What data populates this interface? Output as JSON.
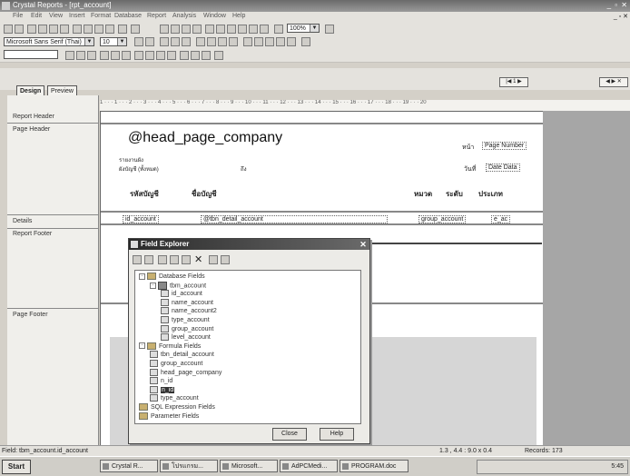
{
  "window": {
    "title": "Crystal Reports - [rpt_account]"
  },
  "menu": [
    "File",
    "Edit",
    "View",
    "Insert",
    "Format",
    "Database",
    "Report",
    "Analysis",
    "Window",
    "Help"
  ],
  "toolbar": {
    "zoom": "100%",
    "font_name": "Microsoft Sans Serif (Thai)",
    "font_size": "10"
  },
  "tabs": [
    {
      "label": "Design"
    },
    {
      "label": "Preview"
    }
  ],
  "nav": {
    "counter": "1"
  },
  "sections": {
    "report_header": "Report Header",
    "page_header": "Page Header",
    "details": "Details",
    "report_footer": "Report Footer",
    "page_footer": "Page Footer"
  },
  "ruler": "1 · · · 1 · · · 2 · · · 3 · · · 4 · · · 5 · · · 6 · · · 7 · · · 8 · · · 9 · · · 10 · · · 11 · · · 12 · · · 13 · · · 14 · · · 15 · · · 16 · · · 17 · · · 18 · · · 19 · · · 20",
  "report": {
    "company_field": "@head_page_company",
    "page_label": "หน้า",
    "page_number": "Page Number",
    "date_label": "วันที่",
    "date_field": "Date Data",
    "title_line1": "รายงานผัง",
    "title_line2": "ผังบัญชี (ทั้งหมด)",
    "small_label": "ถึง",
    "col_code": "รหัสบัญชี",
    "col_name": "ชื่อบัญชี",
    "col_group": "หมวด",
    "col_level": "ระดับ",
    "col_type": "ประเภท",
    "det_id": "id_account",
    "det_name": "@tbn_detail_account",
    "det_group": "group_account",
    "det_type": "e_ac"
  },
  "field_explorer": {
    "title": "Field Explorer",
    "close_label": "Close",
    "help_label": "Help",
    "tree": [
      {
        "label": "Database Fields",
        "indent": 0,
        "kind": "folder",
        "expanded": "-"
      },
      {
        "label": "tbm_account",
        "indent": 1,
        "kind": "table",
        "expanded": "-"
      },
      {
        "label": "id_account",
        "indent": 2,
        "kind": "field"
      },
      {
        "label": "name_account",
        "indent": 2,
        "kind": "field"
      },
      {
        "label": "name_account2",
        "indent": 2,
        "kind": "field"
      },
      {
        "label": "type_account",
        "indent": 2,
        "kind": "field"
      },
      {
        "label": "group_account",
        "indent": 2,
        "kind": "field"
      },
      {
        "label": "level_account",
        "indent": 2,
        "kind": "field"
      },
      {
        "label": "Formula Fields",
        "indent": 0,
        "kind": "folder",
        "expanded": "-"
      },
      {
        "label": "tbn_detail_account",
        "indent": 1,
        "kind": "field"
      },
      {
        "label": "group_account",
        "indent": 1,
        "kind": "field"
      },
      {
        "label": "head_page_company",
        "indent": 1,
        "kind": "field"
      },
      {
        "label": "n_id",
        "indent": 1,
        "kind": "field"
      },
      {
        "label": "n_id",
        "indent": 1,
        "kind": "field",
        "selected": true
      },
      {
        "label": "type_account",
        "indent": 1,
        "kind": "field"
      },
      {
        "label": "SQL Expression Fields",
        "indent": 0,
        "kind": "folder"
      },
      {
        "label": "Parameter Fields",
        "indent": 0,
        "kind": "folder"
      }
    ]
  },
  "statusbar": {
    "field": "Field: tbm_account.id_account",
    "coords": "1.3 , 4.4 : 9.0 x 0.4",
    "records": "Records: 173"
  },
  "taskbar": {
    "start": "Start",
    "tasks": [
      "Crystal R...",
      "โปรแกรม...",
      "Microsoft...",
      "AdPCMedi...",
      "PROGRAM.doc"
    ],
    "clock": "5:45"
  }
}
